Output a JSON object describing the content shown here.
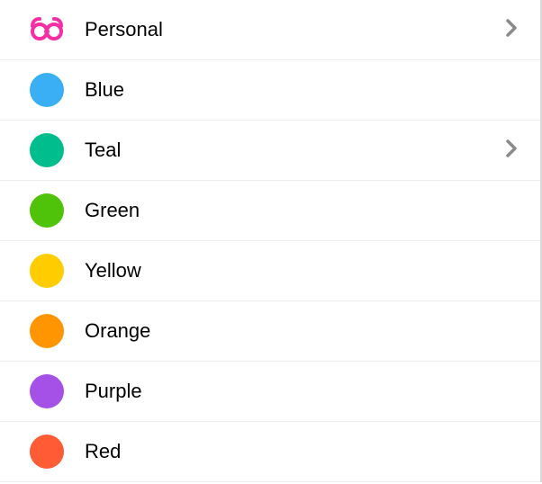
{
  "list": {
    "items": [
      {
        "label": "Personal",
        "type": "glasses",
        "color": "#F52FA3",
        "hasChevron": true
      },
      {
        "label": "Blue",
        "type": "dot",
        "color": "#3AAFF5",
        "hasChevron": false
      },
      {
        "label": "Teal",
        "type": "dot",
        "color": "#00BD8E",
        "hasChevron": true
      },
      {
        "label": "Green",
        "type": "dot",
        "color": "#4FC20A",
        "hasChevron": false
      },
      {
        "label": "Yellow",
        "type": "dot",
        "color": "#FFCC00",
        "hasChevron": false
      },
      {
        "label": "Orange",
        "type": "dot",
        "color": "#FF9500",
        "hasChevron": false
      },
      {
        "label": "Purple",
        "type": "dot",
        "color": "#A550E7",
        "hasChevron": false
      },
      {
        "label": "Red",
        "type": "dot",
        "color": "#FF5B35",
        "hasChevron": false
      }
    ]
  }
}
